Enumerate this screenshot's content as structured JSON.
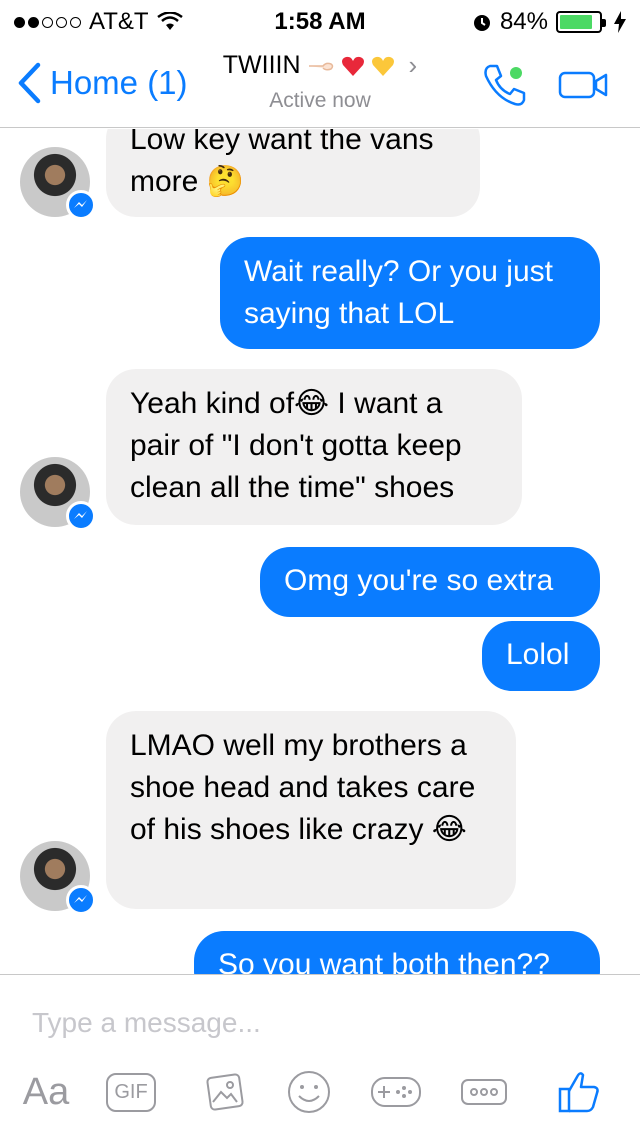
{
  "status_bar": {
    "carrier": "AT&T",
    "time": "1:58 AM",
    "battery": "84%",
    "battery_level": 0.84
  },
  "nav": {
    "back_label": "Home (1)",
    "contact_name": "TWIIIN",
    "status": "Active now"
  },
  "messages": [
    {
      "direction": "in",
      "text": "Low key want the vans more 🤔"
    },
    {
      "direction": "out",
      "text": "Wait really? Or you just saying that LOL"
    },
    {
      "direction": "in",
      "text": "Yeah kind of😂 I want a pair of \"I don't gotta keep clean all the time\" shoes"
    },
    {
      "direction": "out",
      "text": "Omg you're so extra"
    },
    {
      "direction": "out",
      "text": "Lolol"
    },
    {
      "direction": "in",
      "text": "LMAO well my brothers a shoe head and takes care of his shoes like crazy 😂"
    },
    {
      "direction": "out",
      "text": "So you want both then??"
    }
  ],
  "composer": {
    "placeholder": "Type a message...",
    "aa_label": "Aa",
    "gif_label": "GIF"
  },
  "colors": {
    "accent": "#0a7cff",
    "incoming_bubble": "#f1f0f0",
    "online": "#4cd964"
  }
}
